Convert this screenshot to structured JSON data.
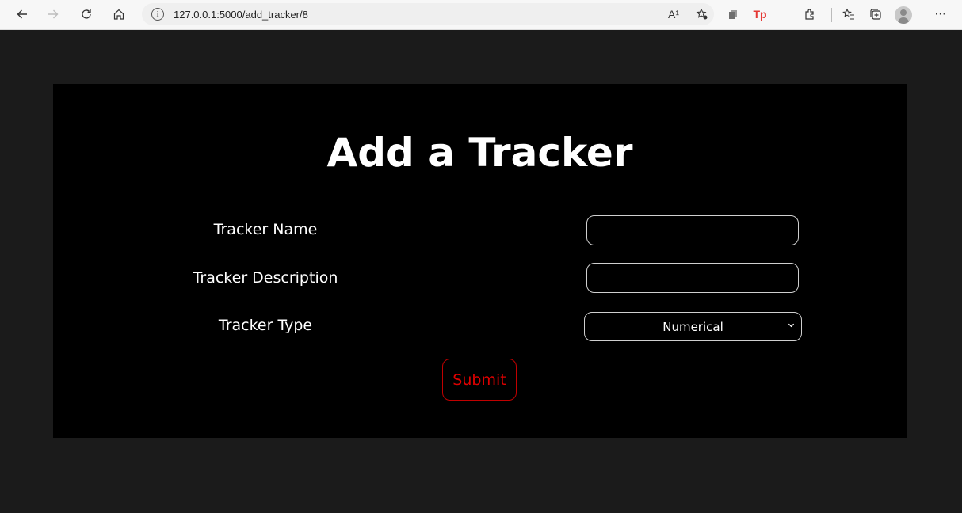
{
  "browser": {
    "url": "127.0.0.1:5000/add_tracker/8",
    "read_aloud_label": "A¹",
    "tp_label": "Tp",
    "more_label": "···",
    "icons": [
      "back-icon",
      "forward-icon",
      "refresh-icon",
      "home-icon",
      "info-icon",
      "read-aloud-icon",
      "favorites-add-icon",
      "extension-icon",
      "tp-extension-icon",
      "puzzle-icon",
      "favorites-icon",
      "collections-icon",
      "profile-avatar",
      "more-icon"
    ]
  },
  "page": {
    "title": "Add a Tracker",
    "fields": {
      "name_label": "Tracker Name",
      "name_value": "",
      "description_label": "Tracker Description",
      "description_value": "",
      "type_label": "Tracker Type",
      "type_selected": "Numerical"
    },
    "submit_label": "Submit"
  },
  "colors": {
    "page_background": "#1b1b1b",
    "card_background": "#000000",
    "text": "#ffffff",
    "submit_accent": "#e00000"
  }
}
